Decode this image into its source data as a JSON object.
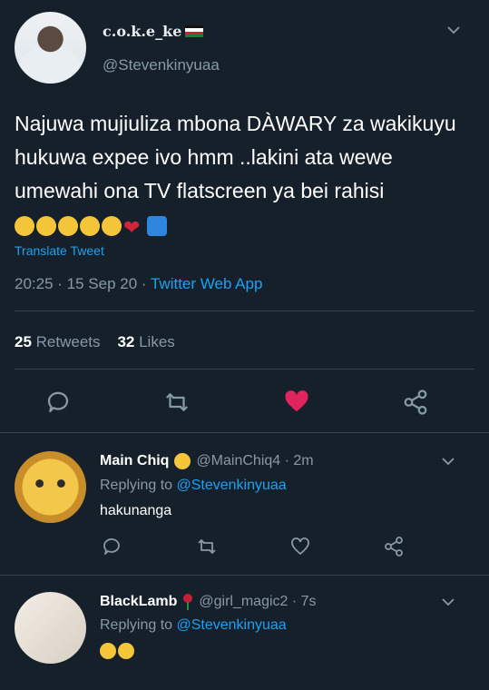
{
  "tweet": {
    "display_name": "c.o.k.e_ke",
    "handle": "@Stevenkinyuaa",
    "text": "Najuwa mujiuliza mbona DÀWARY za wakikuyu hukuwa expee ivo hmm ..lakini ata wewe umewahi ona TV flatscreen ya bei rahisi",
    "translate_label": "Translate Tweet",
    "time": "20:25 · 15 Sep 20 · ",
    "app": "Twitter Web App",
    "retweets_count": "25",
    "retweets_label": "Retweets",
    "likes_count": "32",
    "likes_label": "Likes"
  },
  "replies": [
    {
      "name": "Main Chiq",
      "handle_time": "@MainChiq4 · 2m",
      "replying_prefix": "Replying to",
      "replying_to": "@Stevenkinyuaa",
      "text": "hakunanga"
    },
    {
      "name": "BlackLamb",
      "handle_time": "@girl_magic2 · 7s",
      "replying_prefix": "Replying to",
      "replying_to": "@Stevenkinyuaa"
    }
  ],
  "colors": {
    "background": "#15202b",
    "accent": "#1da1f2",
    "muted": "#8899a6",
    "like_active": "#e0245e"
  },
  "icons": [
    "chevron-down-icon",
    "reply-icon",
    "retweet-icon",
    "heart-icon",
    "share-icon",
    "kenya-flag-icon"
  ]
}
